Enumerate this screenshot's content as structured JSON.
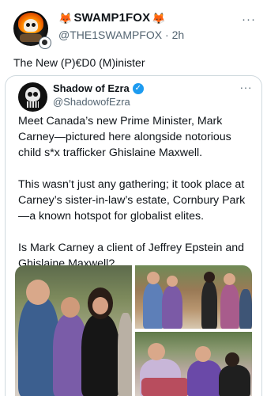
{
  "post": {
    "display_name": "SWAMP1FOX",
    "name_icons": [
      "fox-icon",
      "fox-icon"
    ],
    "handle": "@THE1SWAMPFOX",
    "separator": "·",
    "time": "2h",
    "text": "The New (P)€D0 (M)inister",
    "more_icon": "···"
  },
  "quote": {
    "display_name": "Shadow of Ezra",
    "verified": true,
    "verified_glyph": "✓",
    "handle": "@ShadowofEzra",
    "more_icon": "···",
    "paragraphs": [
      "Meet Canada’s new Prime Minister, Mark Carney—pictured here alongside notorious child s*x trafficker Ghislaine Maxwell.",
      "This wasn’t just any gathering; it took place at Carney’s sister-in-law’s estate, Cornbury Park—a known hotspot for globalist elites.",
      "Is Mark Carney a client of Jeffrey Epstein and Ghislaine Maxwell?"
    ],
    "images": [
      "photo-left",
      "photo-top-right",
      "photo-bottom-right"
    ]
  },
  "colors": {
    "text": "#0f1419",
    "muted": "#536471",
    "verified": "#1d9bf0",
    "border": "#cfd9de",
    "fox": "#e8741c"
  }
}
